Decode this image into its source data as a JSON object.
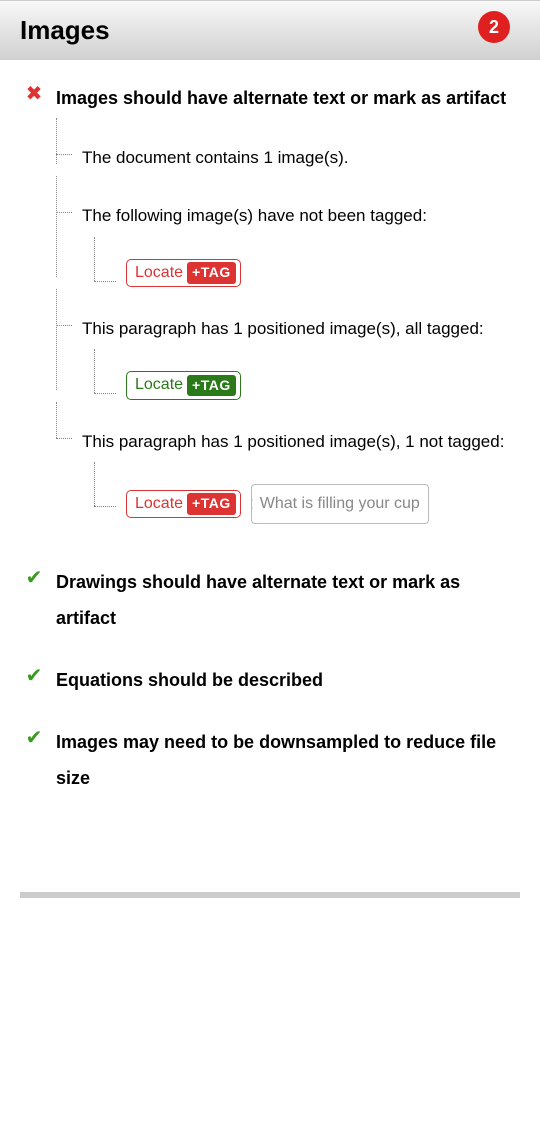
{
  "header": {
    "title": "Images",
    "badge_count": "2"
  },
  "rules": {
    "r0": {
      "title": "Images should have alternate text or mark as artifact",
      "items": {
        "i0": {
          "text": "The document contains 1 image(s)."
        },
        "i1": {
          "text": "The following image(s) have not been tagged:",
          "locate": "Locate",
          "tag": "+TAG"
        },
        "i2": {
          "text": "This paragraph has 1 positioned image(s), all tagged:",
          "locate": "Locate",
          "tag": "+TAG"
        },
        "i3": {
          "text": "This paragraph has 1 positioned image(s), 1 not tagged:",
          "locate": "Locate",
          "tag": "+TAG",
          "hint": "What is filling your cup"
        }
      }
    },
    "r1": {
      "title": "Drawings should have alternate text or mark as artifact"
    },
    "r2": {
      "title": "Equations should be described"
    },
    "r3": {
      "title": "Images may need to be downsampled to reduce file size"
    }
  }
}
